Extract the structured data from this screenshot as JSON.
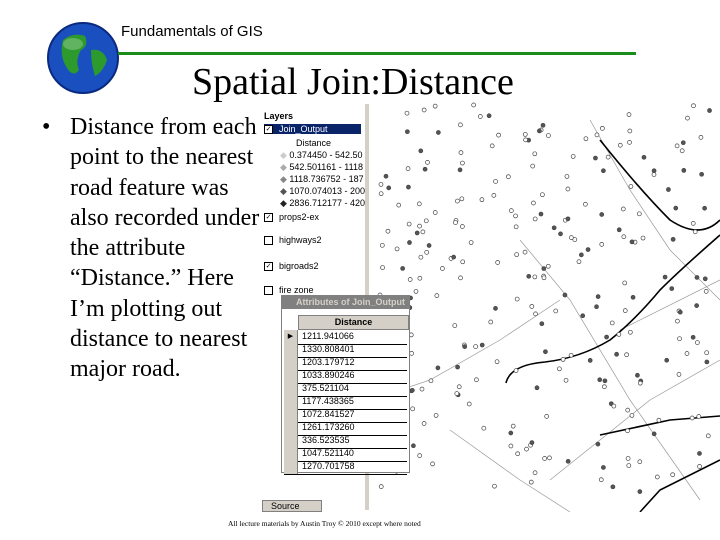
{
  "header": {
    "title": "Fundamentals of GIS",
    "accent": "#1a8c1a"
  },
  "slide": {
    "title": "Spatial Join:Distance",
    "bullet": "Distance from each point to the nearest road feature was also recorded under the attribute “Distance.” Here I’m plotting out distance to nearest major road."
  },
  "layers": {
    "heading": "Layers",
    "items": [
      {
        "label": "Join_Output",
        "checked": true,
        "selected": true
      },
      {
        "label": "Distance",
        "sub": true
      },
      {
        "label": "0.374450 - 542.50",
        "sub": true
      },
      {
        "label": "542.501161 - 1118",
        "sub": true
      },
      {
        "label": "1118.736752 - 187",
        "sub": true
      },
      {
        "label": "1070.074013 - 200",
        "sub": true
      },
      {
        "label": "2836.712177 - 420",
        "sub": true
      },
      {
        "label": "props2-ex",
        "checked": true
      },
      {
        "label": "highways2",
        "checked": false
      },
      {
        "label": "bigroads2",
        "checked": true
      },
      {
        "label": "fire zone",
        "checked": false
      }
    ],
    "tab": "Source"
  },
  "attributes": {
    "title": "Attributes of Join_Output",
    "column": "Distance",
    "rows": [
      "1211.941066",
      "1330.808401",
      "1203.179712",
      "1033.890246",
      "375.521104",
      "1177.438365",
      "1072.841527",
      "1261.173260",
      "336.523535",
      "1047.521140",
      "1270.701758"
    ]
  },
  "footer": "All lecture materials by Austin Troy © 2010 except where noted"
}
